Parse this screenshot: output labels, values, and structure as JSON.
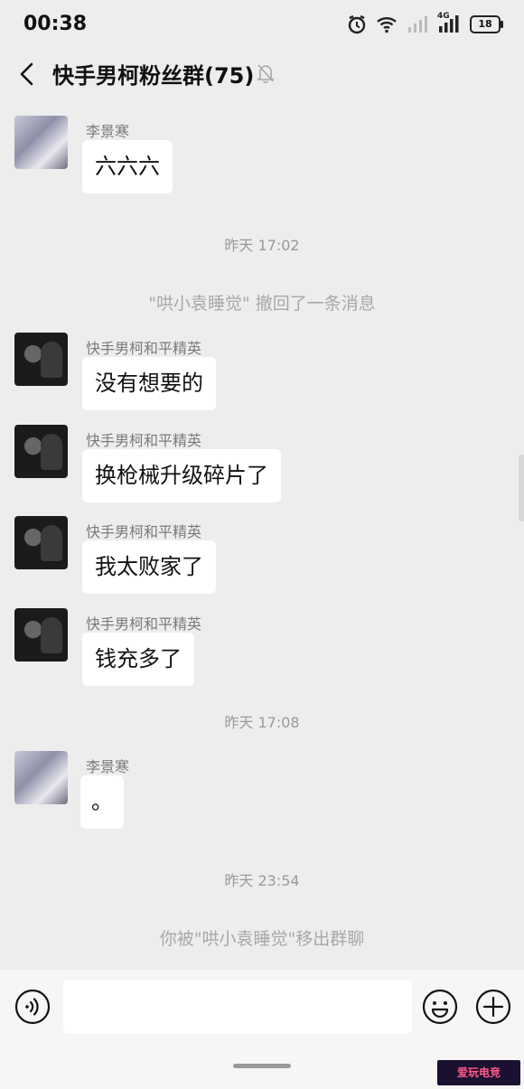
{
  "status_bar": {
    "time": "00:38",
    "network": "4G",
    "battery": "18"
  },
  "header": {
    "title": "快手男柯粉丝群(75)"
  },
  "messages": [
    {
      "sender": "李景寒",
      "text": "六六六"
    },
    {
      "system": "昨天 17:02"
    },
    {
      "system": "\"哄小袁睡觉\" 撤回了一条消息"
    },
    {
      "sender": "快手男柯和平精英",
      "text": "没有想要的"
    },
    {
      "sender": "快手男柯和平精英",
      "text": "换枪械升级碎片了"
    },
    {
      "sender": "快手男柯和平精英",
      "text": "我太败家了"
    },
    {
      "sender": "快手男柯和平精英",
      "text": "钱充多了"
    },
    {
      "system": "昨天 17:08"
    },
    {
      "sender": "李景寒",
      "text": "。"
    },
    {
      "system": "昨天 23:54"
    },
    {
      "system": "你被\"哄小袁睡觉\"移出群聊"
    }
  ],
  "input_bar": {
    "placeholder": ""
  },
  "watermark": {
    "text": "爱玩电竞"
  }
}
